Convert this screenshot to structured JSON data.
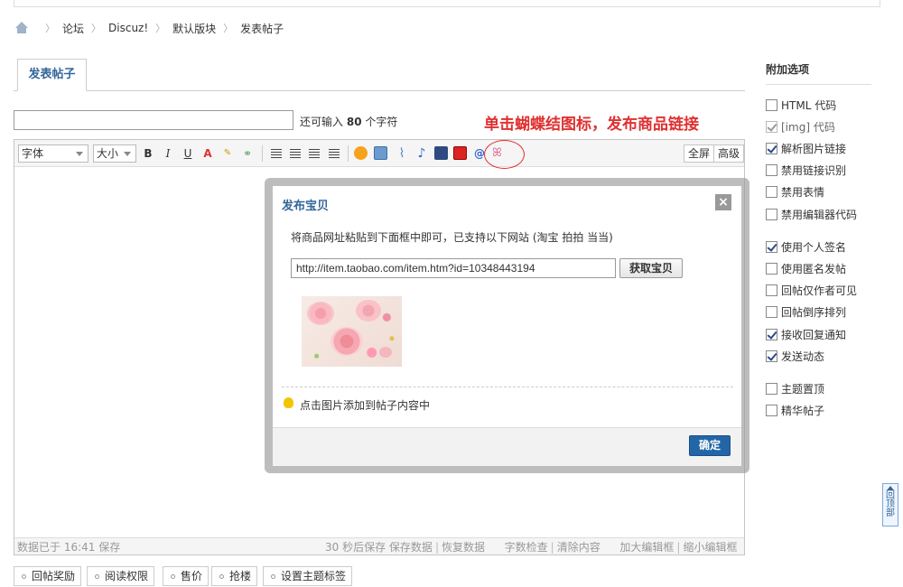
{
  "breadcrumb": [
    "论坛",
    "Discuz!",
    "默认版块",
    "发表帖子"
  ],
  "tab": {
    "label": "发表帖子"
  },
  "title": {
    "value": "",
    "remain_prefix": "还可输入",
    "remain_count": "80",
    "remain_suffix": "个字符"
  },
  "annotation": "单击蝴蝶结图标，发布商品链接",
  "toolbar": {
    "font_label": "字体",
    "size_label": "大小",
    "bold": "B",
    "italic": "I",
    "underline": "U",
    "fullscreen": "全屏",
    "advanced": "高级"
  },
  "status": {
    "saved": "数据已于 16:41 保存",
    "autosave": "30 秒后保存",
    "save_data": "保存数据",
    "restore_data": "恢复数据",
    "word_check": "字数检查",
    "clear": "清除内容",
    "enlarge": "加大编辑框",
    "shrink": "缩小编辑框"
  },
  "dialog": {
    "title": "发布宝贝",
    "close": "×",
    "description": "将商品网址粘贴到下面框中即可，已支持以下网站 (淘宝 拍拍 当当)",
    "url_value": "http://item.taobao.com/item.htm?id=10348443194",
    "fetch_button": "获取宝贝",
    "tip": "点击图片添加到帖子内容中",
    "ok_button": "确定"
  },
  "options": {
    "title": "附加选项",
    "items": [
      {
        "label": "HTML 代码",
        "checked": false,
        "disabled": false
      },
      {
        "label": "[img] 代码",
        "checked": true,
        "disabled": true
      },
      {
        "label": "解析图片链接",
        "checked": true,
        "disabled": false
      },
      {
        "label": "禁用链接识别",
        "checked": false,
        "disabled": false
      },
      {
        "label": "禁用表情",
        "checked": false,
        "disabled": false
      },
      {
        "label": "禁用编辑器代码",
        "checked": false,
        "disabled": false
      },
      {
        "label": "使用个人签名",
        "checked": true,
        "disabled": false
      },
      {
        "label": "使用匿名发帖",
        "checked": false,
        "disabled": false
      },
      {
        "label": "回帖仅作者可见",
        "checked": false,
        "disabled": false
      },
      {
        "label": "回帖倒序排列",
        "checked": false,
        "disabled": false
      },
      {
        "label": "接收回复通知",
        "checked": true,
        "disabled": false
      },
      {
        "label": "发送动态",
        "checked": true,
        "disabled": false
      },
      {
        "label": "主题置顶",
        "checked": false,
        "disabled": false
      },
      {
        "label": "精华帖子",
        "checked": false,
        "disabled": false
      }
    ]
  },
  "back_to_top": "回顶部",
  "bottom_buttons": [
    "回帖奖励",
    "阅读权限",
    "售价",
    "抢楼",
    "设置主题标签"
  ],
  "colors": {
    "accent": "#336699",
    "annotation": "#e03030",
    "ok_button": "#2366a8"
  }
}
